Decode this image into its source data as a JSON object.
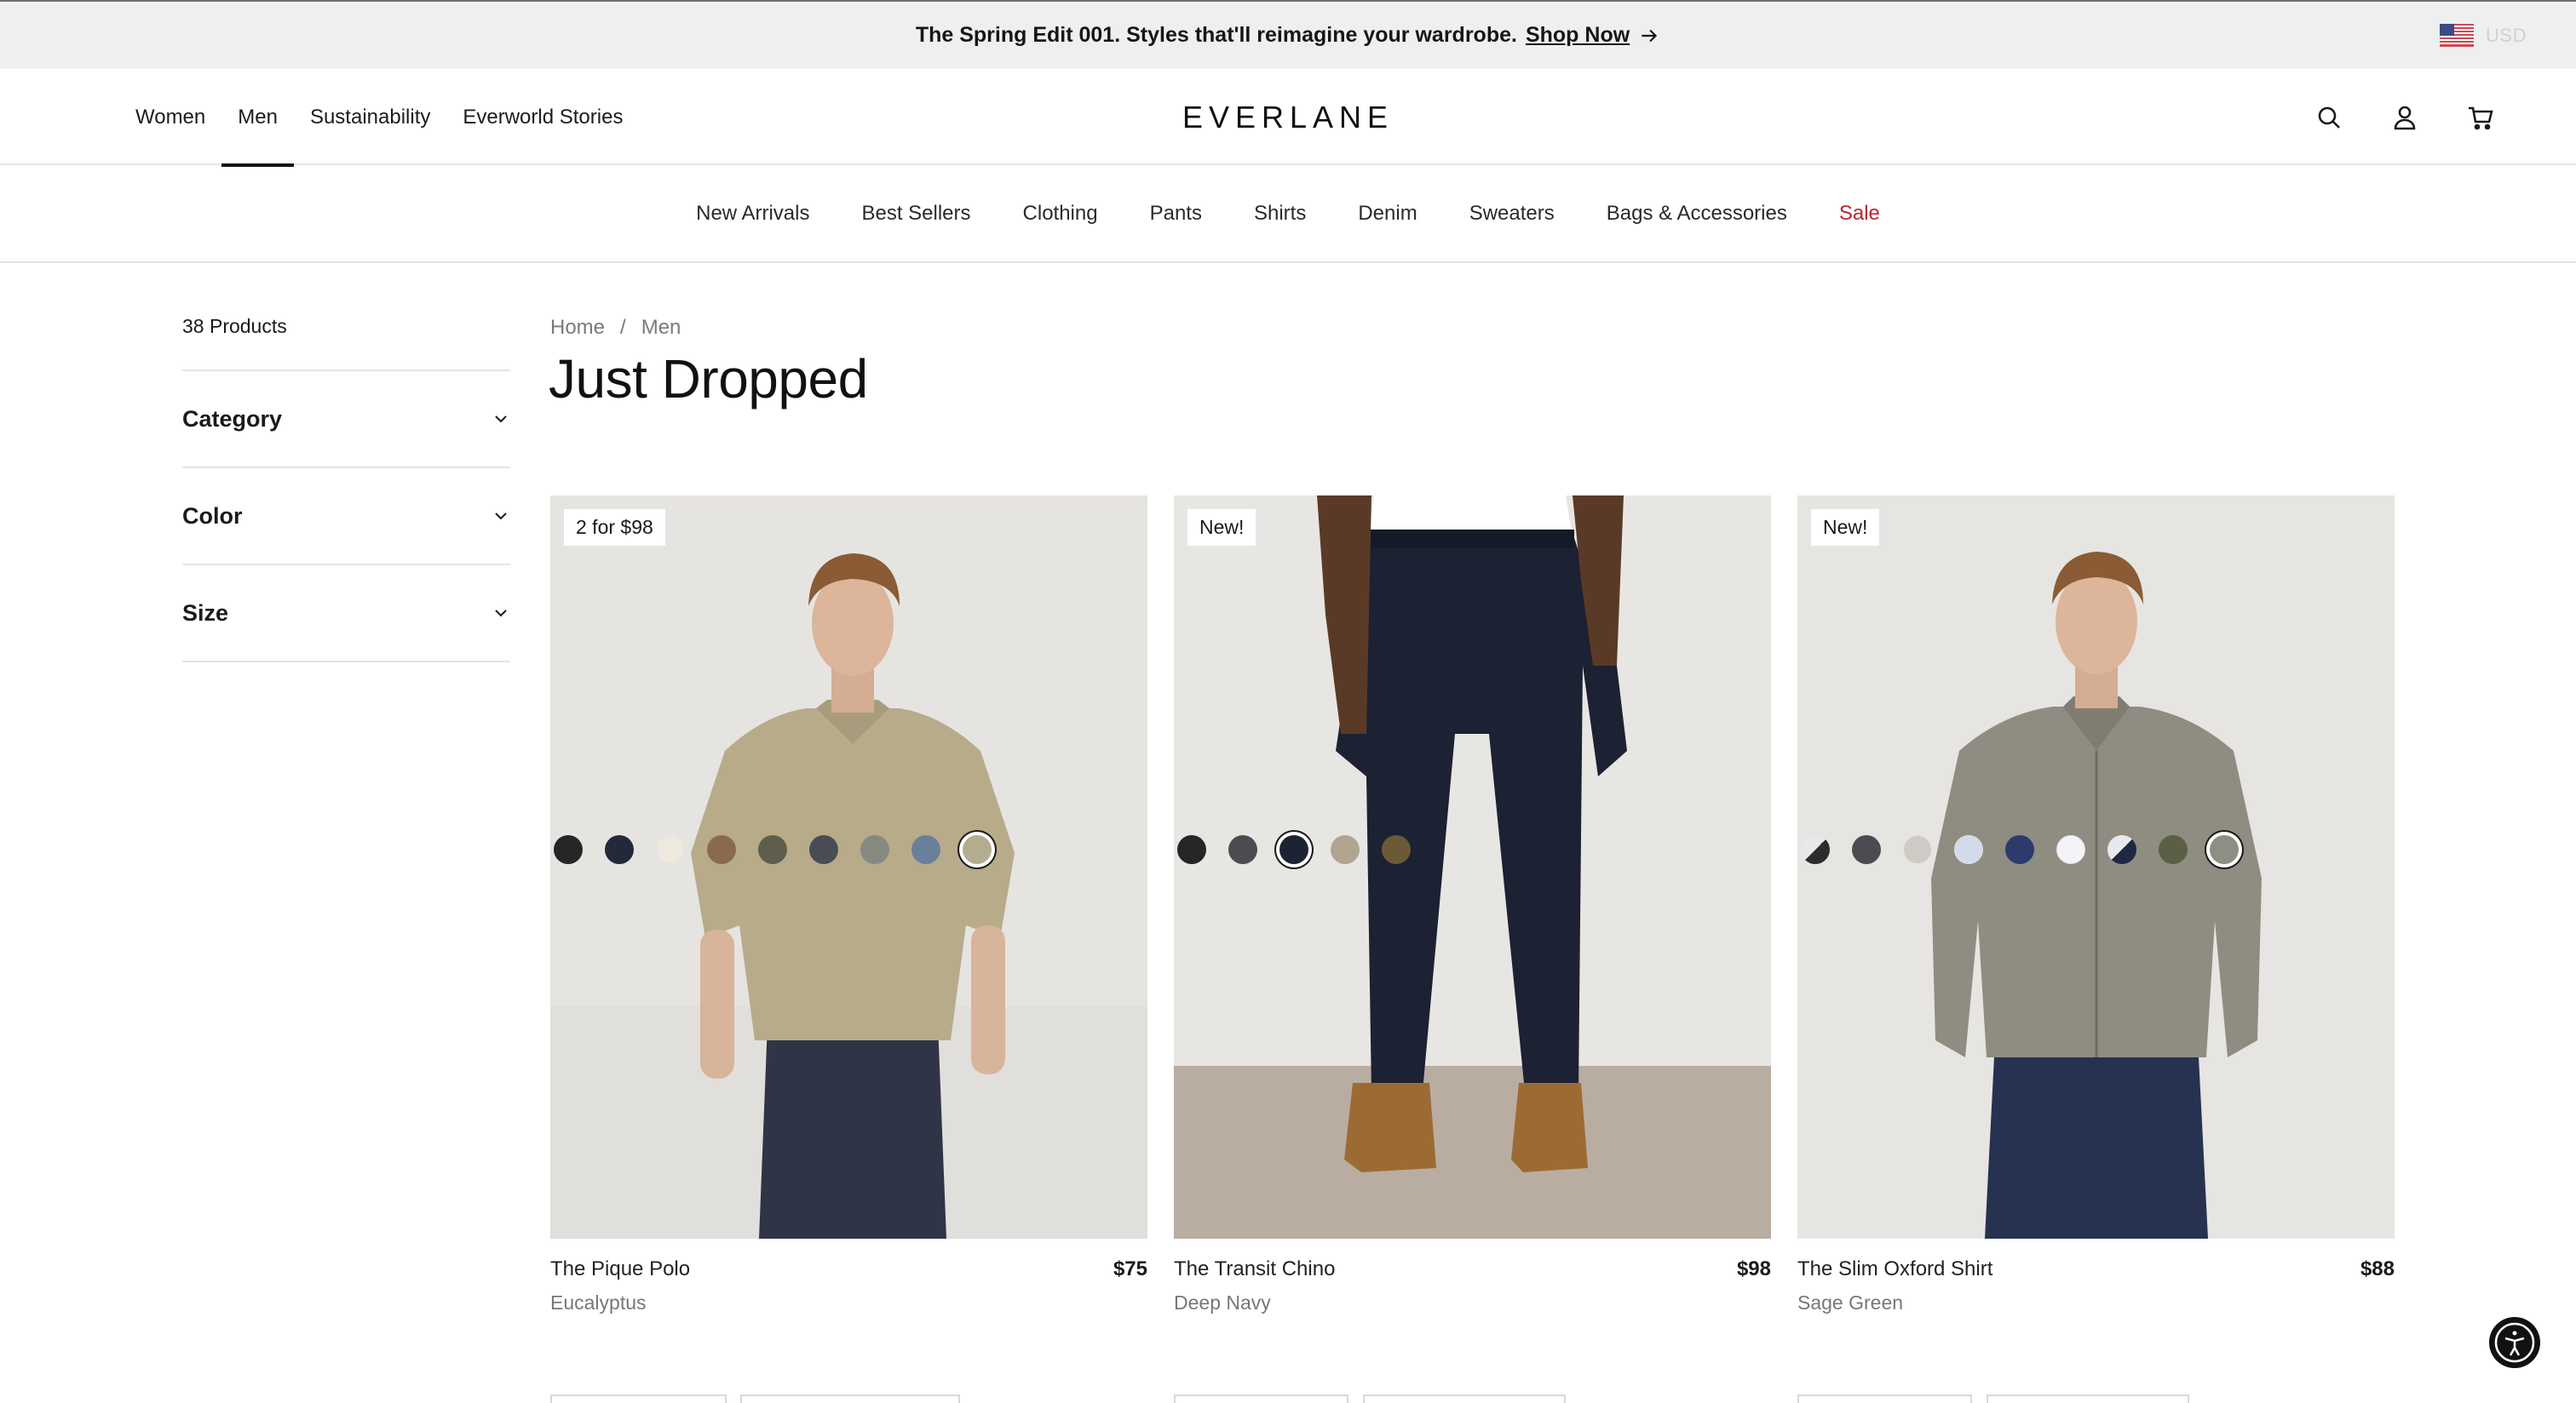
{
  "promo": {
    "text": "The Spring Edit 001. Styles that'll reimagine your wardrobe.",
    "link": "Shop Now",
    "currency": "USD"
  },
  "header": {
    "logo": "EVERLANE",
    "nav": [
      {
        "label": "Women",
        "active": false
      },
      {
        "label": "Men",
        "active": true
      },
      {
        "label": "Sustainability",
        "active": false
      },
      {
        "label": "Everworld Stories",
        "active": false
      }
    ],
    "icons": [
      "search-icon",
      "account-icon",
      "cart-icon"
    ]
  },
  "subnav": [
    {
      "label": "New Arrivals"
    },
    {
      "label": "Best Sellers"
    },
    {
      "label": "Clothing"
    },
    {
      "label": "Pants"
    },
    {
      "label": "Shirts"
    },
    {
      "label": "Denim"
    },
    {
      "label": "Sweaters"
    },
    {
      "label": "Bags & Accessories"
    },
    {
      "label": "Sale",
      "color": "#b5282e"
    }
  ],
  "sidebar": {
    "product_count": "38 Products",
    "filters": [
      "Category",
      "Color",
      "Size"
    ]
  },
  "breadcrumb": {
    "items": [
      "Home",
      "Men"
    ],
    "separator": "/"
  },
  "page_title": "Just Dropped",
  "products": [
    {
      "badge": "2 for $98",
      "name": "The Pique Polo",
      "price": "$75",
      "color": "Eucalyptus",
      "swatches": [
        "#262626",
        "#23283a",
        "#efe8df",
        "#8a6a4e",
        "#5d5e4b",
        "#4a4d55",
        "#86897f",
        "#6a7f99",
        "#b3ad8f"
      ],
      "selected_swatch": 8
    },
    {
      "badge": "New!",
      "name": "The Transit Chino",
      "price": "$98",
      "color": "Deep Navy",
      "swatches": [
        "#262626",
        "#4a4c50",
        "#1d2333",
        "#b1a591",
        "#6b5a35"
      ],
      "selected_swatch": 2
    },
    {
      "badge": "New!",
      "name": "The Slim Oxford Shirt",
      "price": "$88",
      "color": "Sage Green",
      "swatches": [
        "split:#e8e8e8:#2c2c2c",
        "#4a4c52",
        "#cfcac4",
        "#d3dbea",
        "#2c3b6c",
        "#f3f4f8",
        "split:#e7e9ef:#1f2742",
        "#5b5f45",
        "#8d8f84"
      ],
      "selected_swatch": 8
    }
  ]
}
